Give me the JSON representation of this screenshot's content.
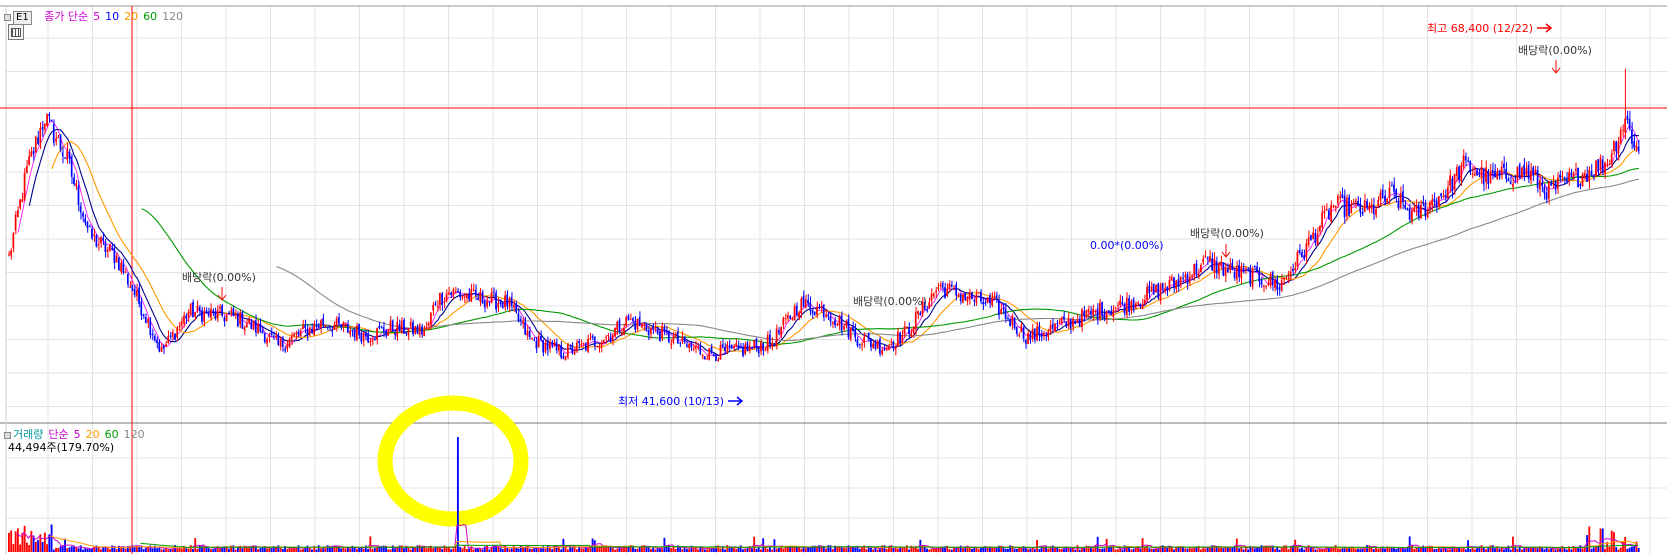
{
  "price_panel": {
    "tab_label": "E1",
    "indicator_name": "종가 단순",
    "ma_periods": [
      "5",
      "10",
      "20",
      "60",
      "120"
    ],
    "ma_colors": [
      "#0000ff",
      "#00008b",
      "#ff9900",
      "#009900",
      "#888888"
    ]
  },
  "volume_panel": {
    "indicator_name": "거래량",
    "ma_label": "단순",
    "ma_periods": [
      "5",
      "20",
      "60",
      "120"
    ],
    "ma_colors": [
      "#cc00cc",
      "#ff9900",
      "#009900",
      "#888888"
    ],
    "current_value": "44,494주(179.70%)"
  },
  "annotations": {
    "high_label": "최고 68,400 (12/22)",
    "low_label": "최저 41,600 (10/13)",
    "dividend_labels": [
      "배당락(0.00%)",
      "배당락(0.00%)",
      "0.00*(0.00%)",
      "배당락(0.00%)",
      "배당락(0.00%)"
    ]
  },
  "colors": {
    "up": "#ff0000",
    "down": "#0000ff",
    "grid": "#e3e3e3",
    "highlight": "#ffff00"
  },
  "chart_data": {
    "type": "candlestick",
    "price_range": [
      36000,
      74000
    ],
    "high": 68400,
    "low": 41600,
    "anchors": [
      [
        0,
        51000
      ],
      [
        8,
        59000
      ],
      [
        16,
        64000
      ],
      [
        26,
        60000
      ],
      [
        36,
        53000
      ],
      [
        48,
        51000
      ],
      [
        60,
        46000
      ],
      [
        68,
        42300
      ],
      [
        80,
        46000
      ],
      [
        100,
        45500
      ],
      [
        112,
        44300
      ],
      [
        120,
        42800
      ],
      [
        130,
        44000
      ],
      [
        140,
        45000
      ],
      [
        160,
        43800
      ],
      [
        170,
        44500
      ],
      [
        186,
        44200
      ],
      [
        190,
        47000
      ],
      [
        196,
        47800
      ],
      [
        210,
        47200
      ],
      [
        222,
        46800
      ],
      [
        232,
        43500
      ],
      [
        246,
        42200
      ],
      [
        256,
        42800
      ],
      [
        266,
        43700
      ],
      [
        276,
        45200
      ],
      [
        290,
        44000
      ],
      [
        302,
        42800
      ],
      [
        312,
        42100
      ],
      [
        326,
        42400
      ],
      [
        340,
        43200
      ],
      [
        352,
        46700
      ],
      [
        364,
        46100
      ],
      [
        378,
        43600
      ],
      [
        390,
        42700
      ],
      [
        400,
        44100
      ],
      [
        414,
        48300
      ],
      [
        426,
        47400
      ],
      [
        440,
        46500
      ],
      [
        454,
        43600
      ],
      [
        468,
        44700
      ],
      [
        486,
        46100
      ],
      [
        500,
        46800
      ],
      [
        520,
        48700
      ],
      [
        534,
        50600
      ],
      [
        544,
        49700
      ],
      [
        556,
        49200
      ],
      [
        566,
        48400
      ],
      [
        576,
        51300
      ],
      [
        590,
        55800
      ],
      [
        606,
        55300
      ],
      [
        616,
        56800
      ],
      [
        626,
        54800
      ],
      [
        640,
        57100
      ],
      [
        648,
        59500
      ],
      [
        660,
        58200
      ],
      [
        676,
        58900
      ],
      [
        686,
        57100
      ],
      [
        700,
        58600
      ],
      [
        712,
        59800
      ],
      [
        720,
        63800
      ],
      [
        726,
        60600
      ]
    ],
    "volume_spike": [
      200,
      1.0
    ]
  }
}
